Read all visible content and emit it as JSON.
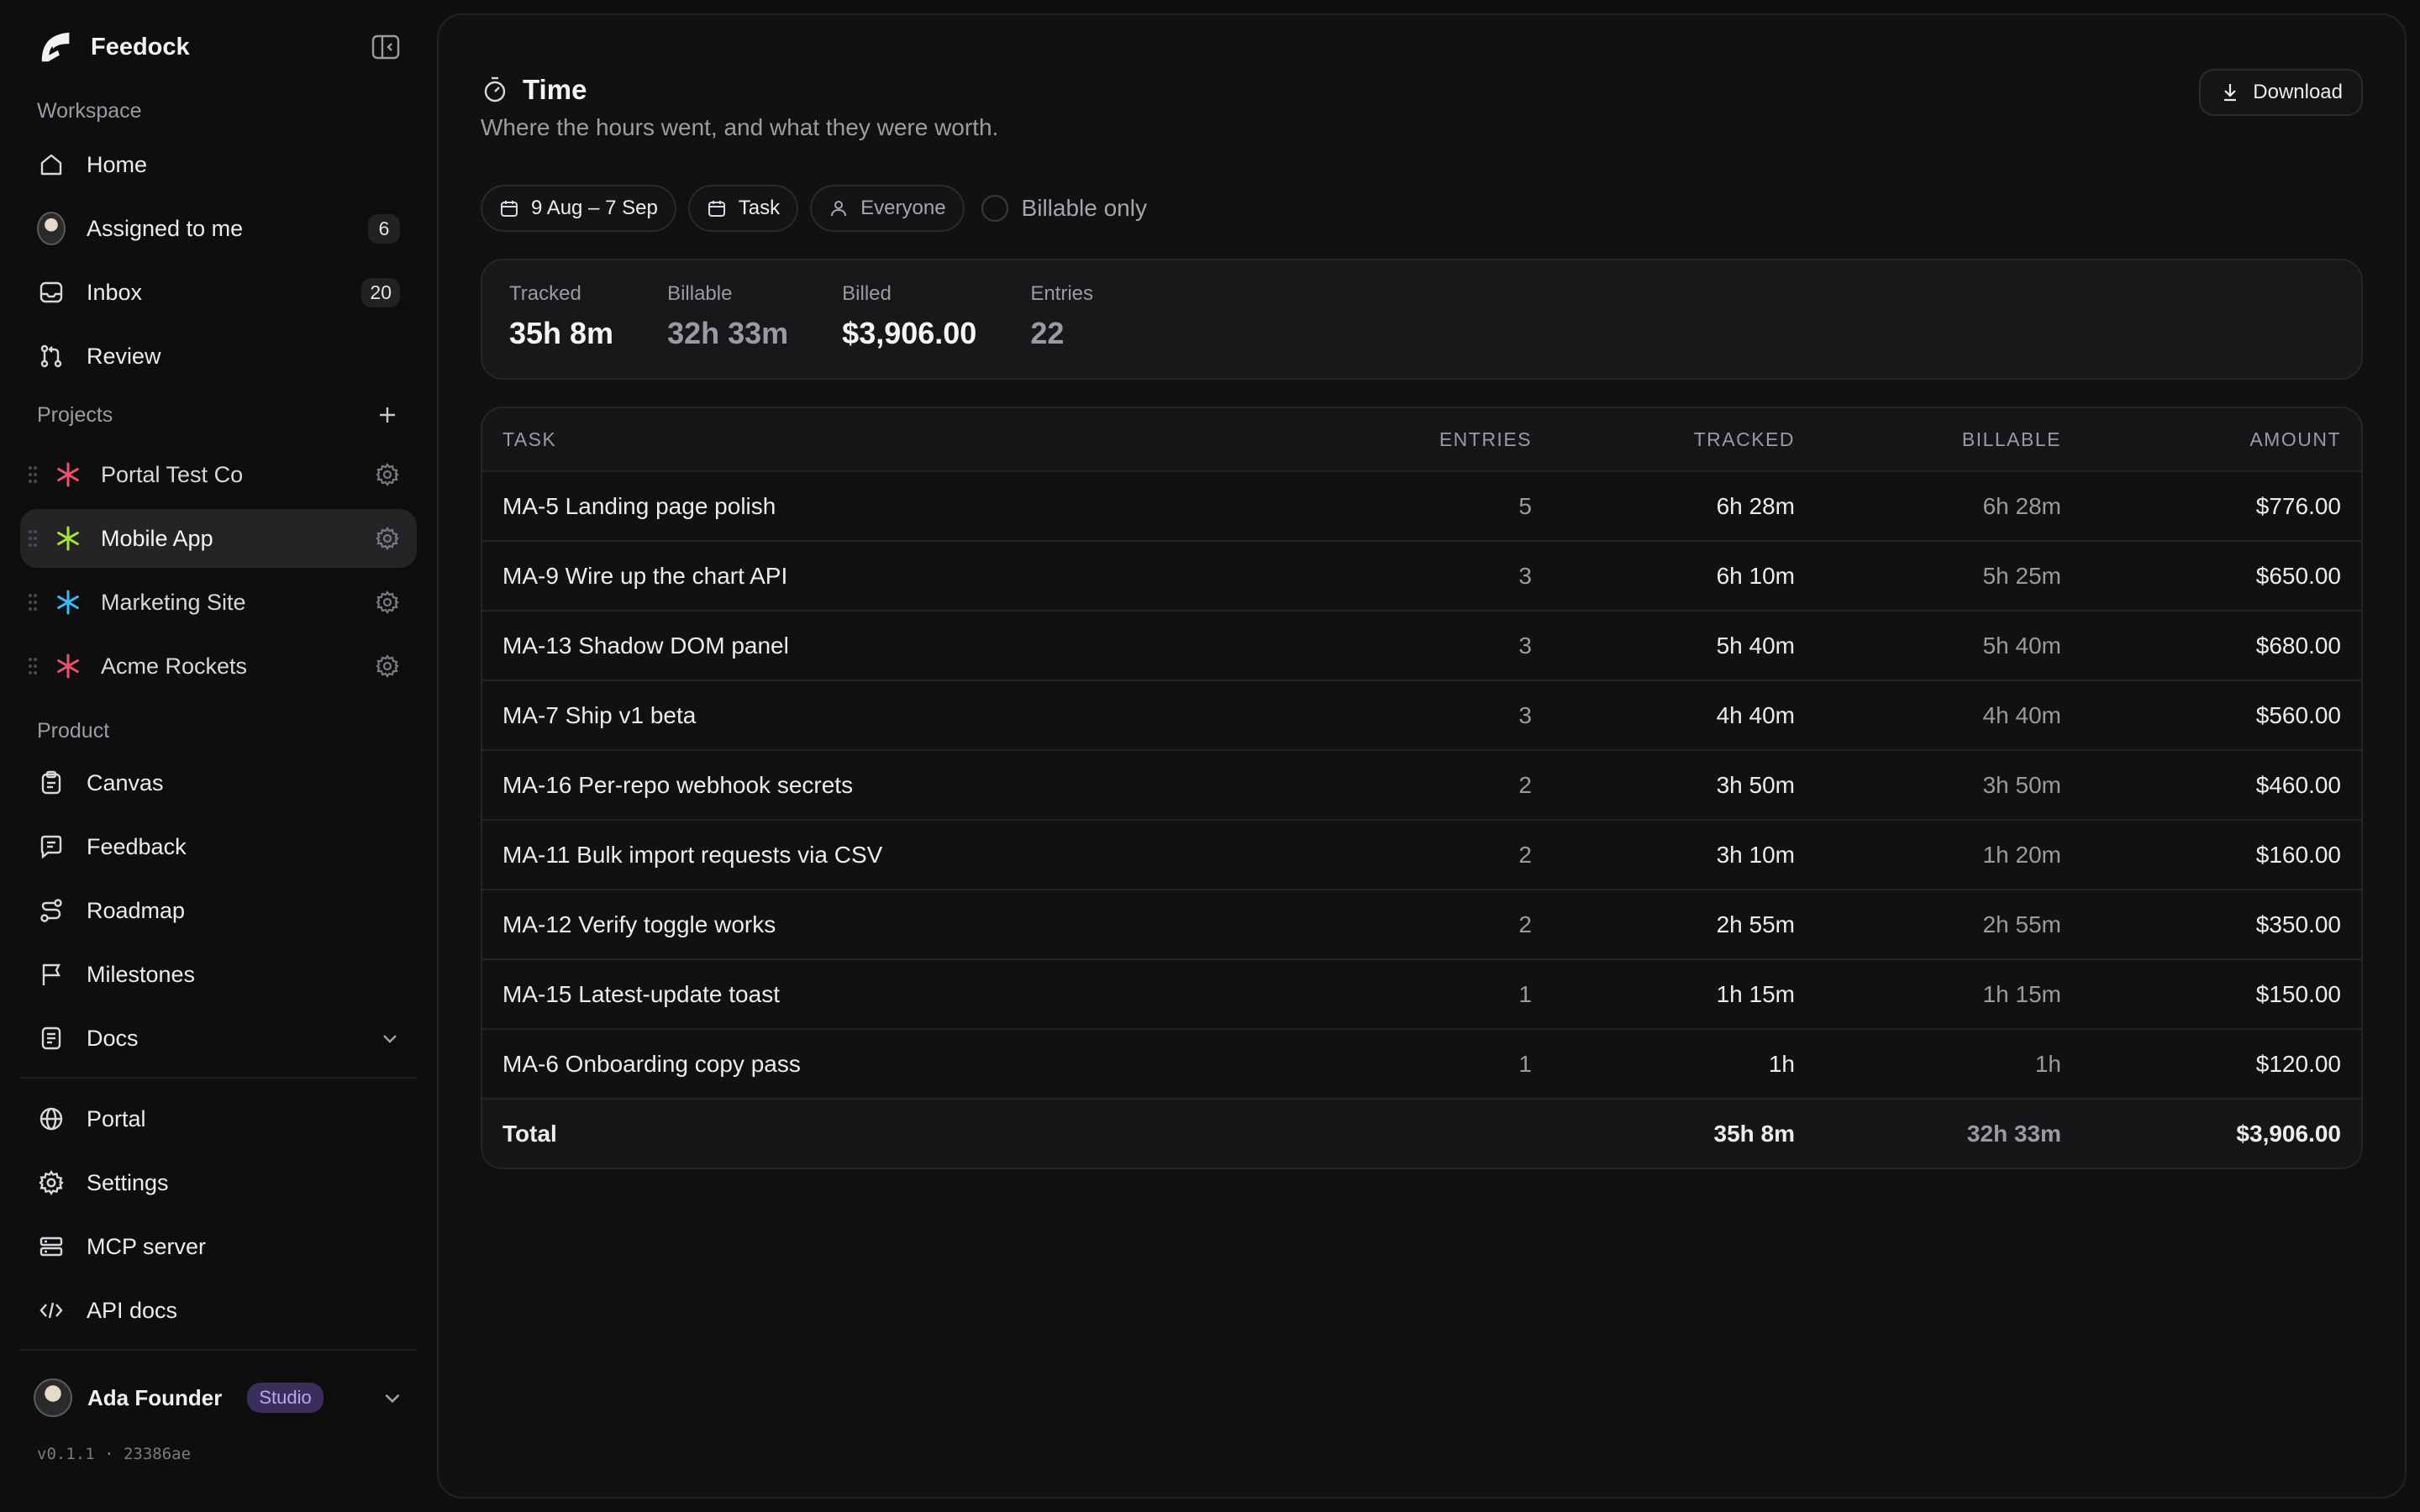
{
  "app": {
    "name": "Feedock"
  },
  "sidebar": {
    "workspace_label": "Workspace",
    "workspace_items": [
      {
        "label": "Home",
        "icon": "home-icon"
      },
      {
        "label": "Assigned to me",
        "icon": "avatar",
        "count": "6"
      },
      {
        "label": "Inbox",
        "icon": "inbox-icon",
        "count": "20"
      },
      {
        "label": "Review",
        "icon": "git-pull-request-icon"
      }
    ],
    "projects_label": "Projects",
    "projects": [
      {
        "label": "Portal Test Co",
        "color": "#f0506e"
      },
      {
        "label": "Mobile App",
        "color": "#a3e635",
        "active": true
      },
      {
        "label": "Marketing Site",
        "color": "#38bdf8"
      },
      {
        "label": "Acme Rockets",
        "color": "#f0506e"
      }
    ],
    "product_label": "Product",
    "product_items": [
      {
        "label": "Canvas",
        "icon": "clipboard-icon"
      },
      {
        "label": "Feedback",
        "icon": "message-icon"
      },
      {
        "label": "Roadmap",
        "icon": "route-icon"
      },
      {
        "label": "Milestones",
        "icon": "flag-icon"
      },
      {
        "label": "Docs",
        "icon": "document-icon"
      }
    ],
    "bottom_items": [
      {
        "label": "Portal",
        "icon": "globe-icon"
      },
      {
        "label": "Settings",
        "icon": "gear-icon"
      },
      {
        "label": "MCP server",
        "icon": "server-icon"
      },
      {
        "label": "API docs",
        "icon": "code-icon"
      }
    ],
    "user": {
      "name": "Ada Founder",
      "plan": "Studio"
    },
    "version": "v0.1.1 · 23386ae"
  },
  "page": {
    "title": "Time",
    "subtitle": "Where the hours went, and what they were worth.",
    "download_label": "Download",
    "filters": {
      "date_range": "9 Aug – 7 Sep",
      "group_by": "Task",
      "people": "Everyone",
      "billable_only": "Billable only"
    },
    "stats": [
      {
        "label": "Tracked",
        "value": "35h 8m"
      },
      {
        "label": "Billable",
        "value": "32h 33m"
      },
      {
        "label": "Billed",
        "value": "$3,906.00"
      },
      {
        "label": "Entries",
        "value": "22"
      }
    ]
  },
  "table": {
    "columns": [
      "TASK",
      "ENTRIES",
      "TRACKED",
      "BILLABLE",
      "AMOUNT"
    ],
    "rows": [
      {
        "task": "MA-5 Landing page polish",
        "entries": "5",
        "tracked": "6h 28m",
        "billable": "6h 28m",
        "amount": "$776.00"
      },
      {
        "task": "MA-9 Wire up the chart API",
        "entries": "3",
        "tracked": "6h 10m",
        "billable": "5h 25m",
        "amount": "$650.00"
      },
      {
        "task": "MA-13 Shadow DOM panel",
        "entries": "3",
        "tracked": "5h 40m",
        "billable": "5h 40m",
        "amount": "$680.00"
      },
      {
        "task": "MA-7 Ship v1 beta",
        "entries": "3",
        "tracked": "4h 40m",
        "billable": "4h 40m",
        "amount": "$560.00"
      },
      {
        "task": "MA-16 Per-repo webhook secrets",
        "entries": "2",
        "tracked": "3h 50m",
        "billable": "3h 50m",
        "amount": "$460.00"
      },
      {
        "task": "MA-11 Bulk import requests via CSV",
        "entries": "2",
        "tracked": "3h 10m",
        "billable": "1h 20m",
        "amount": "$160.00"
      },
      {
        "task": "MA-12 Verify toggle works",
        "entries": "2",
        "tracked": "2h 55m",
        "billable": "2h 55m",
        "amount": "$350.00"
      },
      {
        "task": "MA-15 Latest-update toast",
        "entries": "1",
        "tracked": "1h 15m",
        "billable": "1h 15m",
        "amount": "$150.00"
      },
      {
        "task": "MA-6 Onboarding copy pass",
        "entries": "1",
        "tracked": "1h",
        "billable": "1h",
        "amount": "$120.00"
      }
    ],
    "total": {
      "label": "Total",
      "tracked": "35h 8m",
      "billable": "32h 33m",
      "amount": "$3,906.00"
    }
  }
}
